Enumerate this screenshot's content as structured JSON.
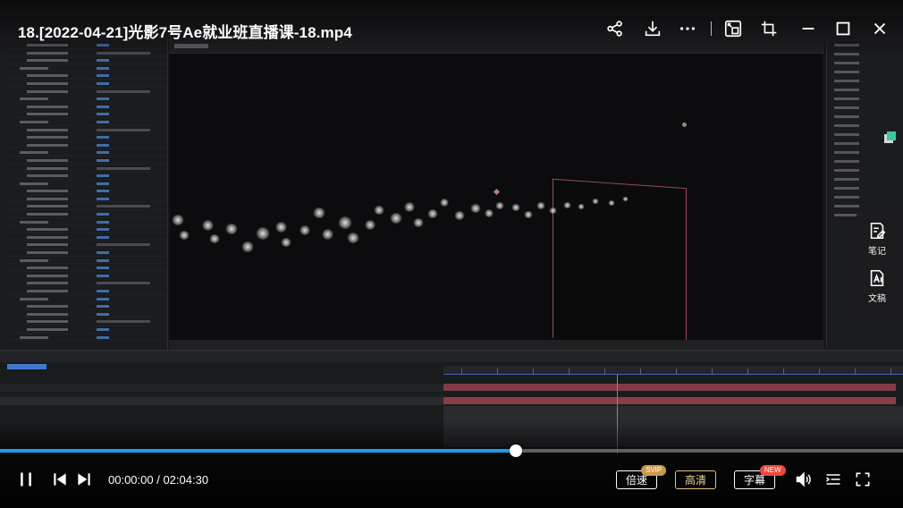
{
  "player": {
    "title": "18.[2022-04-21]光影7号Ae就业班直播课-18.mp4",
    "current_time": "00:00:00",
    "duration": "02:04:30",
    "time_separator": " / ",
    "progress": 0.571,
    "accent_color": "#1f9cf0"
  },
  "top_controls": {
    "icons": [
      "share-icon",
      "download-icon",
      "more-icon",
      "picture-in-picture-icon",
      "crop-icon",
      "minimize-icon",
      "maximize-icon",
      "close-icon"
    ]
  },
  "side_panel": {
    "notes_label": "笔记",
    "transcript_label": "文稿"
  },
  "bottom_controls": {
    "speed_label": "倍速",
    "speed_badge": "SVIP",
    "quality_label": "高清",
    "subtitle_label": "字幕",
    "subtitle_badge": "NEW",
    "icons": [
      "pause-icon",
      "previous-icon",
      "next-icon",
      "volume-icon",
      "playlist-icon",
      "fullscreen-icon"
    ]
  },
  "colors": {
    "svip_badge": "#c99a4b",
    "new_badge": "#f0463c",
    "quality_border": "#e8c27a"
  }
}
